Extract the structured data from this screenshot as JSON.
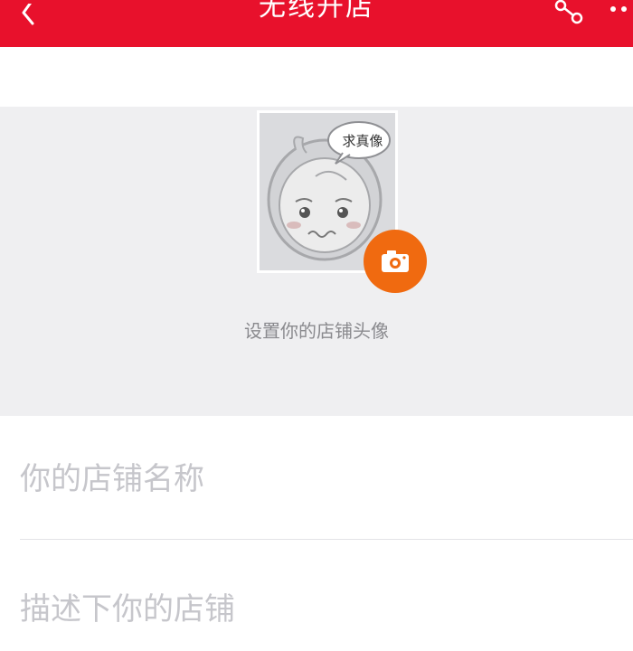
{
  "header": {
    "title": "无线开店"
  },
  "avatar": {
    "speech_bubble": "求真像",
    "hint": "设置你的店铺头像"
  },
  "form": {
    "name_placeholder": "你的店铺名称",
    "description_placeholder": "描述下你的店铺"
  },
  "colors": {
    "header_bg": "#e8112c",
    "camera_button": "#f06a10",
    "section_bg": "#efeff1"
  }
}
